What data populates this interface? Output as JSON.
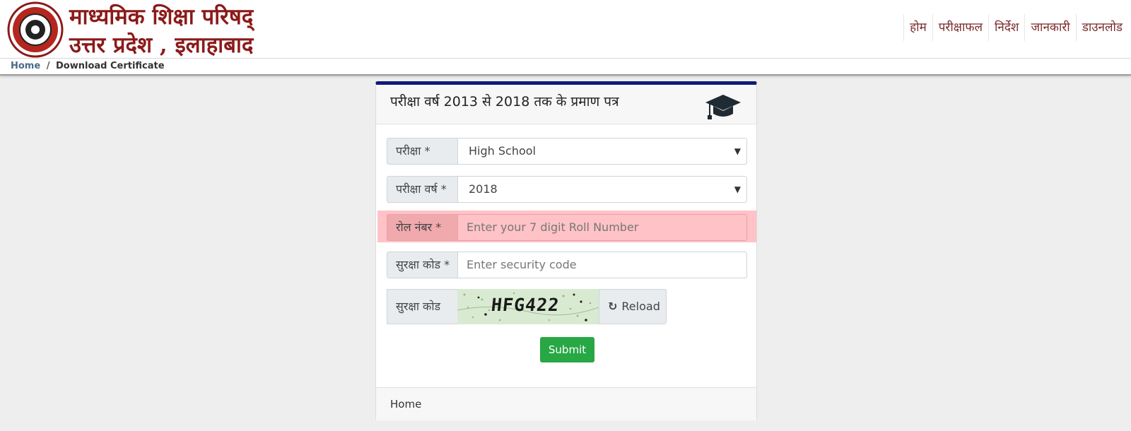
{
  "brand": {
    "line1": "माध्यमिक शिक्षा परिषद्",
    "line2": "उत्तर प्रदेश , इलाहाबाद",
    "color": "#8b1a1a"
  },
  "nav": {
    "items": [
      {
        "label": "होम"
      },
      {
        "label": "परीक्षाफल"
      },
      {
        "label": "निर्देश"
      },
      {
        "label": "जानकारी"
      },
      {
        "label": "डाउनलोड"
      }
    ]
  },
  "breadcrumb": {
    "home": "Home",
    "separator": "/",
    "current": "Download Certificate"
  },
  "card": {
    "title": "परीक्षा वर्ष 2013 से 2018 तक के प्रमाण पत्र",
    "accent_color": "#0d1b7a",
    "exam": {
      "label": "परीक्षा *",
      "value": "High School"
    },
    "year": {
      "label": "परीक्षा वर्ष *",
      "value": "2018"
    },
    "roll": {
      "label": "रोल नंबर *",
      "placeholder": "Enter your 7 digit Roll Number"
    },
    "security": {
      "label": "सुरक्षा कोड *",
      "placeholder": "Enter security code"
    },
    "captcha": {
      "label": "सुरक्षा कोड",
      "text": "HFG422",
      "reload_label": "Reload"
    },
    "submit_label": "Submit",
    "submit_color": "#28a745",
    "footer": "Home"
  },
  "icons": {
    "logo": "up-board-seal",
    "cap": "graduation-cap-icon",
    "reload": "refresh-icon",
    "caret": "caret-down-icon"
  }
}
